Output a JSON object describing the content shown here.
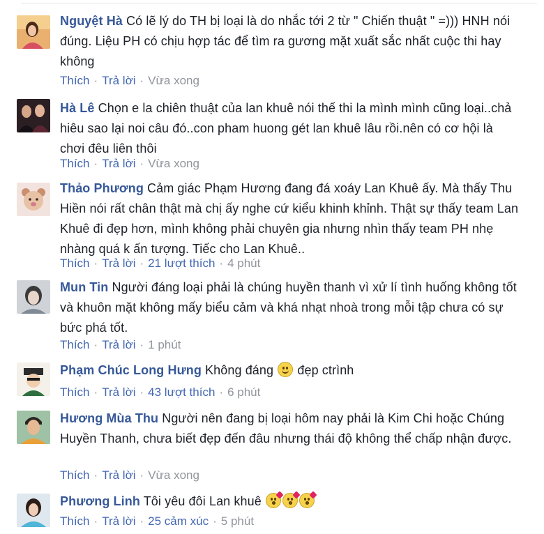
{
  "comments": [
    {
      "author": "Nguyệt Hà",
      "text": "Có lẽ lý do TH bị loại là do nhắc tới 2 từ \" Chiến thuật \" =))) HNH nói đúng. Liệu PH có chịu hợp tác để tìm ra gương mặt xuất sắc nhất cuộc thi hay không",
      "like_label": "Thích",
      "reply_label": "Trả lời",
      "time": "Vừa xong",
      "avatar_icon": "user-avatar-woman-portrait"
    },
    {
      "author": "Hà Lê",
      "text": "Chọn e la chiên thuật của lan khuê nói thế thi la mình mình cũng loại..chả hiêu sao lại noi câu đó..con pham huong gét lan khuê lâu rồi.nên có cơ hội là chơi đêu liên thôi",
      "like_label": "Thích",
      "reply_label": "Trả lời",
      "time": "Vừa xong",
      "avatar_icon": "user-avatar-group-photo"
    },
    {
      "author": "Thảo Phương",
      "text": "Cảm giác Phạm Hương đang đá xoáy Lan Khuê ấy. Mà thấy Thu Hiền nói rất chân thật mà chị ấy nghe cứ kiểu khinh khỉnh. Thật sự thấy team Lan Khuê đi đẹp hơn, mình không phải chuyên gia nhưng nhìn thấy team PH nhẹ nhàng quá k ấn tượng. Tiếc cho Lan Khuê..",
      "like_label": "Thích",
      "reply_label": "Trả lời",
      "likes": "21 lượt thích",
      "time": "4 phút",
      "avatar_icon": "user-avatar-teddy-bear"
    },
    {
      "author": "Mun Tin",
      "text": "Người đáng loại phải là chúng huyền thanh vì xử lí tình huống không tốt và khuôn mặt không mấy biểu cảm và khá nhạt nhoà trong mỗi tập chưa có sự bức phá tốt.",
      "like_label": "Thích",
      "reply_label": "Trả lời",
      "time": "1 phút",
      "avatar_icon": "user-avatar-portrait"
    },
    {
      "author": "Phạm Chúc Long Hưng",
      "text_before": "Không đáng",
      "text_after": "đẹp ctrình",
      "emoji_icon": "smile-emoji-icon",
      "like_label": "Thích",
      "reply_label": "Trả lời",
      "likes": "43 lượt thích",
      "time": "6 phút",
      "avatar_icon": "user-avatar-cartoon"
    },
    {
      "author": "Hương Mùa Thu",
      "text": "Người nên đang bị loại hôm nay phải là Kim Chi hoặc Chúng Huyền Thanh, chưa biết đẹp đến đâu nhưng thái độ không thể chấp nhận được.",
      "like_label": "Thích",
      "reply_label": "Trả lời",
      "time": "Vừa xong",
      "avatar_icon": "user-avatar-man-portrait"
    },
    {
      "author": "Phương Linh",
      "text_before": "Tôi yêu đôi Lan khuê",
      "emoji_icon": "kiss-emoji-icon",
      "like_label": "Thích",
      "reply_label": "Trả lời",
      "likes": "25 cảm xúc",
      "time": "5 phút",
      "avatar_icon": "user-avatar-woman-portrait"
    }
  ],
  "colors": {
    "author": "#365899",
    "link": "#4267b2",
    "meta": "#90949c",
    "text": "#1d2129"
  }
}
